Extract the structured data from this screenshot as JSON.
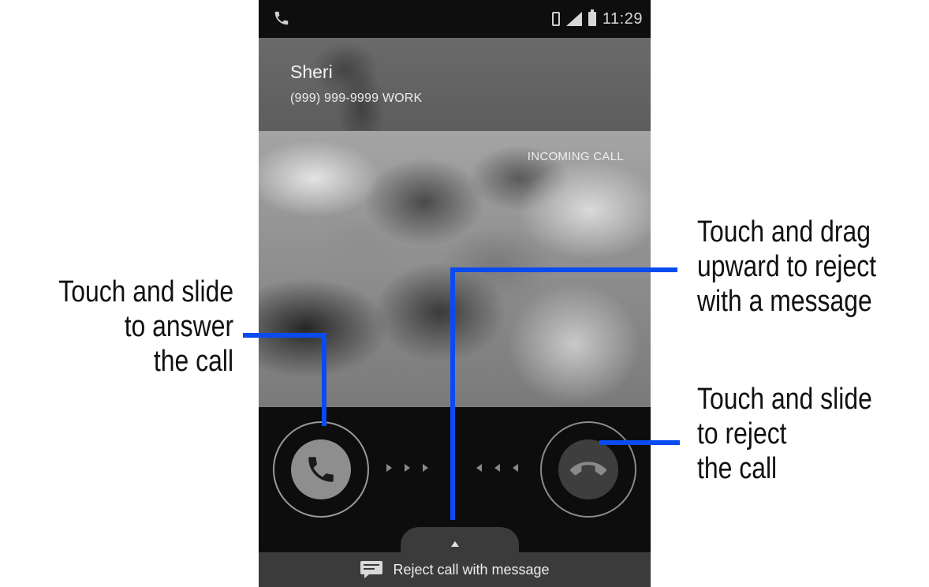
{
  "status_bar": {
    "time": "11:29",
    "icons": [
      "phone-icon",
      "vibrate-icon",
      "signal-icon",
      "battery-icon"
    ]
  },
  "caller": {
    "name": "Sheri",
    "number": "(999) 999-9999  WORK"
  },
  "call_status": "INCOMING CALL",
  "controls": {
    "answer_icon": "phone-answer-icon",
    "reject_icon": "phone-hangup-icon"
  },
  "reject_with_message": {
    "label": "Reject call with message",
    "icon": "message-icon"
  },
  "annotations": {
    "answer": [
      "Touch and slide",
      "to answer",
      "the call"
    ],
    "drag": [
      "Touch and drag",
      "upward to reject",
      "with a message"
    ],
    "reject": [
      "Touch and slide",
      "to reject",
      "the call"
    ]
  },
  "colors": {
    "leader_line": "#0a4bf0",
    "screen_background": "#0b0b0b",
    "header_background": "#5d5d5d",
    "tab_background": "#3b3b3b"
  }
}
